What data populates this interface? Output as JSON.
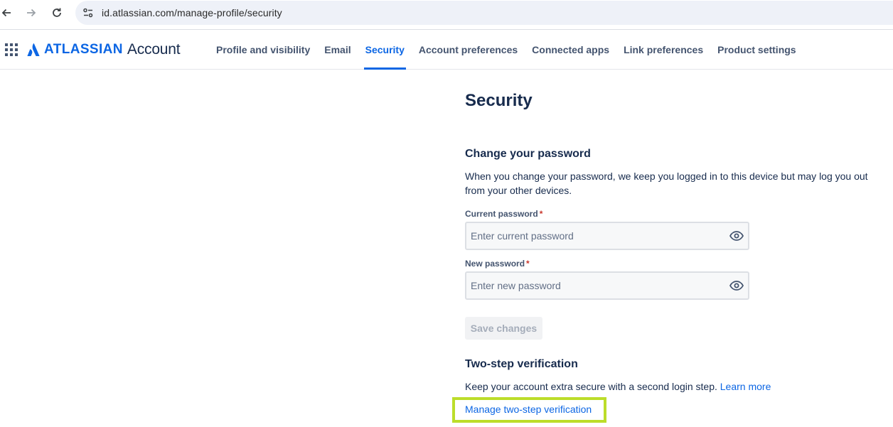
{
  "browser": {
    "url": "id.atlassian.com/manage-profile/security",
    "back_icon": "arrow-left-icon",
    "forward_icon": "arrow-right-icon",
    "reload_icon": "reload-icon",
    "site_info_icon": "tune-icon"
  },
  "header": {
    "brand": "ATLASSIAN",
    "product": "Account",
    "tabs": [
      {
        "label": "Profile and visibility",
        "active": false
      },
      {
        "label": "Email",
        "active": false
      },
      {
        "label": "Security",
        "active": true
      },
      {
        "label": "Account preferences",
        "active": false
      },
      {
        "label": "Connected apps",
        "active": false
      },
      {
        "label": "Link preferences",
        "active": false
      },
      {
        "label": "Product settings",
        "active": false
      }
    ]
  },
  "main": {
    "title": "Security",
    "password": {
      "heading": "Change your password",
      "description": "When you change your password, we keep you logged in to this device but may log you out from your other devices.",
      "current_label": "Current password",
      "current_placeholder": "Enter current password",
      "current_value": "",
      "new_label": "New password",
      "new_placeholder": "Enter new password",
      "new_value": "",
      "required_mark": "*",
      "save_label": "Save changes"
    },
    "two_step": {
      "heading": "Two-step verification",
      "description": "Keep your account extra secure with a second login step.",
      "learn_more": "Learn more",
      "manage_link": "Manage two-step verification"
    }
  },
  "colors": {
    "accent": "#0c66e4",
    "text": "#172b4d",
    "highlight": "#bcdd2a",
    "required": "#c9372c"
  }
}
